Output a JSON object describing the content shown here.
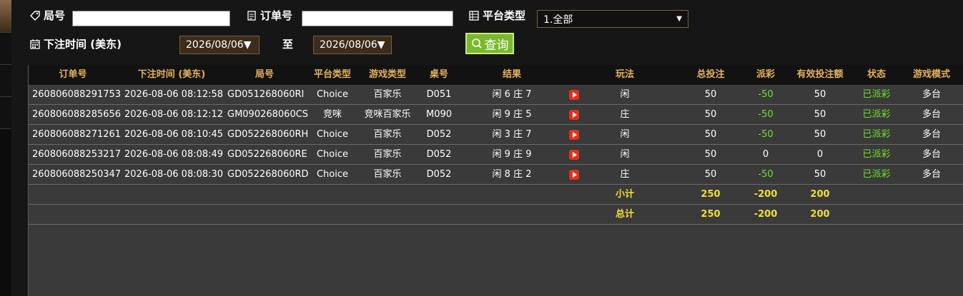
{
  "filters": {
    "round_label": "局号",
    "round_value": "",
    "order_label": "订单号",
    "order_value": "",
    "platform_label": "平台类型",
    "platform_selected": "1.全部",
    "bet_time_label": "下注时间 (美东)",
    "date_from": "2026/08/06▼",
    "to_label": "至",
    "date_to": "2026/08/06▼",
    "query_label": "查询"
  },
  "table": {
    "headers": [
      "订单号",
      "下注时间 (美东)",
      "局号",
      "平台类型",
      "游戏类型",
      "桌号",
      "结果",
      "玩法",
      "总投注",
      "派彩",
      "有效投注额",
      "状态",
      "游戏模式"
    ],
    "rows": [
      [
        "260806088291753",
        "2026-08-06 08:12:58",
        "GD051268060RI",
        "Choice",
        "百家乐",
        "D051",
        "闲 6 庄 7",
        "闲",
        "50",
        "-50",
        "50",
        "已派彩",
        "多台"
      ],
      [
        "260806088285656",
        "2026-08-06 08:12:12",
        "GM090268060CS",
        "竞咪",
        "竞咪百家乐",
        "M090",
        "闲 9 庄 5",
        "庄",
        "50",
        "-50",
        "50",
        "已派彩",
        "多台"
      ],
      [
        "260806088271261",
        "2026-08-06 08:10:45",
        "GD052268060RH",
        "Choice",
        "百家乐",
        "D052",
        "闲 3 庄 7",
        "闲",
        "50",
        "-50",
        "50",
        "已派彩",
        "多台"
      ],
      [
        "260806088253217",
        "2026-08-06 08:08:49",
        "GD052268060RE",
        "Choice",
        "百家乐",
        "D052",
        "闲 9 庄 9",
        "闲",
        "50",
        "0",
        "0",
        "已派彩",
        "多台"
      ],
      [
        "260806088250347",
        "2026-08-06 08:08:30",
        "GD052268060RD",
        "Choice",
        "百家乐",
        "D052",
        "闲 8 庄 2",
        "庄",
        "50",
        "-50",
        "50",
        "已派彩",
        "多台"
      ]
    ],
    "subtotal": {
      "label": "小计",
      "total_bet": "250",
      "payout": "-200",
      "valid_bet": "200"
    },
    "total": {
      "label": "总计",
      "total_bet": "250",
      "payout": "-200",
      "valid_bet": "200"
    }
  },
  "colors": {
    "header_text": "#e5b25e",
    "payout_negative": "#6fe02a",
    "status_paid": "#6fe02a",
    "summary_text": "#f0e032",
    "query_button": "#7ab92e"
  },
  "icons": [
    "tag-icon",
    "document-icon",
    "table-icon",
    "calendar-icon",
    "search-icon",
    "play-video-icon"
  ]
}
